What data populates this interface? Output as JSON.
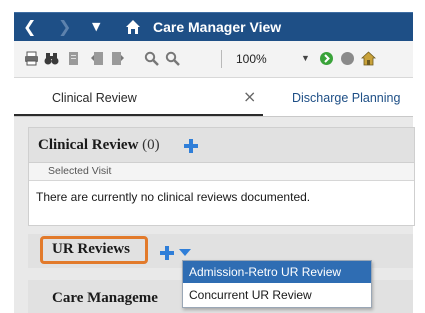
{
  "titlebar": {
    "title": "Care Manager View",
    "icons": [
      "back-arrow-icon",
      "forward-arrow-icon",
      "dropdown-caret-icon",
      "home-icon"
    ]
  },
  "toolbar": {
    "zoom": "100%",
    "icons": [
      "print-icon",
      "binoculars-icon",
      "page-icon",
      "page-first-icon",
      "page-last-icon",
      "zoom-out-icon",
      "zoom-in-icon",
      "go-green-icon",
      "stop-grey-icon",
      "home-refresh-icon"
    ]
  },
  "tabs": [
    {
      "label": "Clinical Review",
      "active": true
    },
    {
      "label": "Discharge Planning",
      "active": false
    }
  ],
  "clinical_review": {
    "title": "Clinical Review",
    "count": "(0)",
    "selected_visit": "Selected Visit",
    "empty_message": "There are currently no clinical reviews documented."
  },
  "ur_reviews": {
    "title": "UR Reviews",
    "menu": [
      "Admission-Retro UR Review",
      "Concurrent UR Review"
    ]
  },
  "care_management": {
    "title": "Care Manageme"
  },
  "colors": {
    "titlebar": "#1e4f86",
    "accent_blue": "#2f7ed8",
    "highlight_orange": "#e27a2b",
    "menu_selected": "#2f6db3"
  }
}
